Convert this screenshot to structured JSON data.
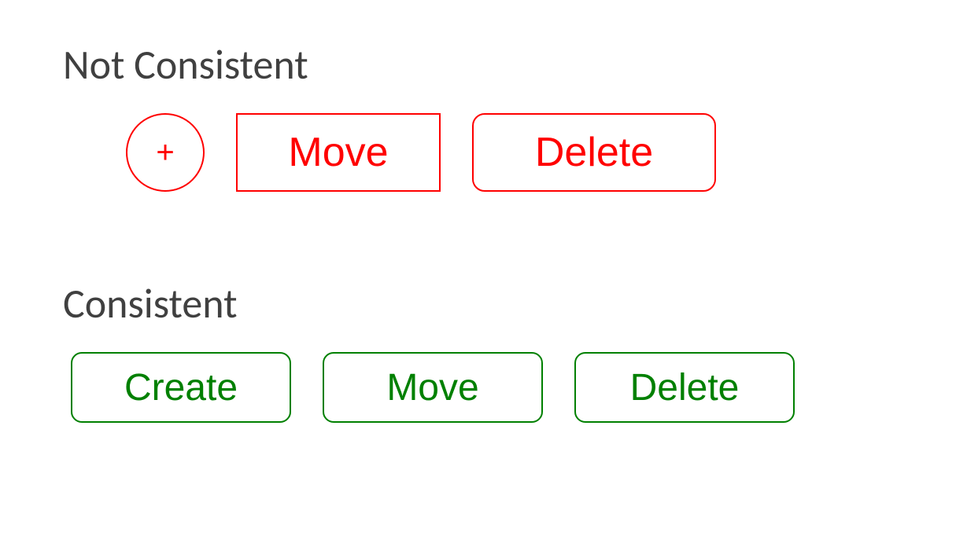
{
  "sections": {
    "not_consistent": {
      "title": "Not Consistent",
      "buttons": {
        "add_icon": "+",
        "move": "Move",
        "delete": "Delete"
      }
    },
    "consistent": {
      "title": "Consistent",
      "buttons": {
        "create": "Create",
        "move": "Move",
        "delete": "Delete"
      }
    }
  },
  "colors": {
    "not_consistent": "#ff0000",
    "consistent": "#008000",
    "title": "#404040"
  }
}
